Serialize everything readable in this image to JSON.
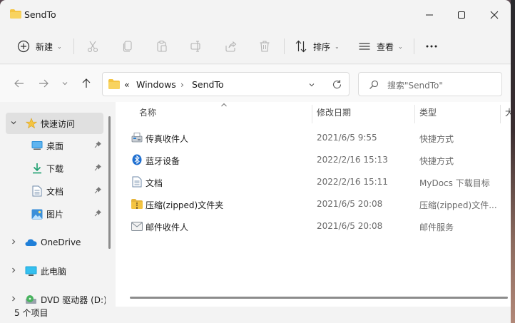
{
  "window": {
    "title": "SendTo"
  },
  "toolbar": {
    "new_label": "新建",
    "sort_label": "排序",
    "view_label": "查看"
  },
  "address": {
    "overflow": "«",
    "segments": [
      "Windows",
      "SendTo"
    ]
  },
  "search": {
    "placeholder": "搜索\"SendTo\""
  },
  "sidebar": {
    "items": [
      {
        "label": "快速访问",
        "icon": "star-icon"
      },
      {
        "label": "桌面",
        "icon": "desktop-icon",
        "pinned": true
      },
      {
        "label": "下载",
        "icon": "download-icon",
        "pinned": true
      },
      {
        "label": "文档",
        "icon": "document-icon",
        "pinned": true
      },
      {
        "label": "图片",
        "icon": "picture-icon",
        "pinned": true
      },
      {
        "label": "OneDrive",
        "icon": "cloud-icon"
      },
      {
        "label": "此电脑",
        "icon": "pc-icon"
      },
      {
        "label": "DVD 驱动器 (D:)",
        "icon": "dvd-icon"
      }
    ]
  },
  "columns": {
    "name": "名称",
    "date": "修改日期",
    "type": "类型",
    "size": "大"
  },
  "files": [
    {
      "name": "传真收件人",
      "date": "2021/6/5 9:55",
      "type": "快捷方式",
      "icon": "fax-icon"
    },
    {
      "name": "蓝牙设备",
      "date": "2022/2/16 15:13",
      "type": "快捷方式",
      "icon": "bluetooth-icon"
    },
    {
      "name": "文档",
      "date": "2022/2/16 15:11",
      "type": "MyDocs 下载目标",
      "icon": "document-icon"
    },
    {
      "name": "压缩(zipped)文件夹",
      "date": "2021/6/5 20:08",
      "type": "压缩(zipped)文件...",
      "icon": "zip-folder-icon"
    },
    {
      "name": "邮件收件人",
      "date": "2021/6/5 20:08",
      "type": "邮件服务",
      "icon": "mail-icon"
    }
  ],
  "status": {
    "count": "5 个项目"
  },
  "colors": {
    "folder": "#f4c441",
    "accent": "#0067c0",
    "selection": "#e0e0e0"
  }
}
